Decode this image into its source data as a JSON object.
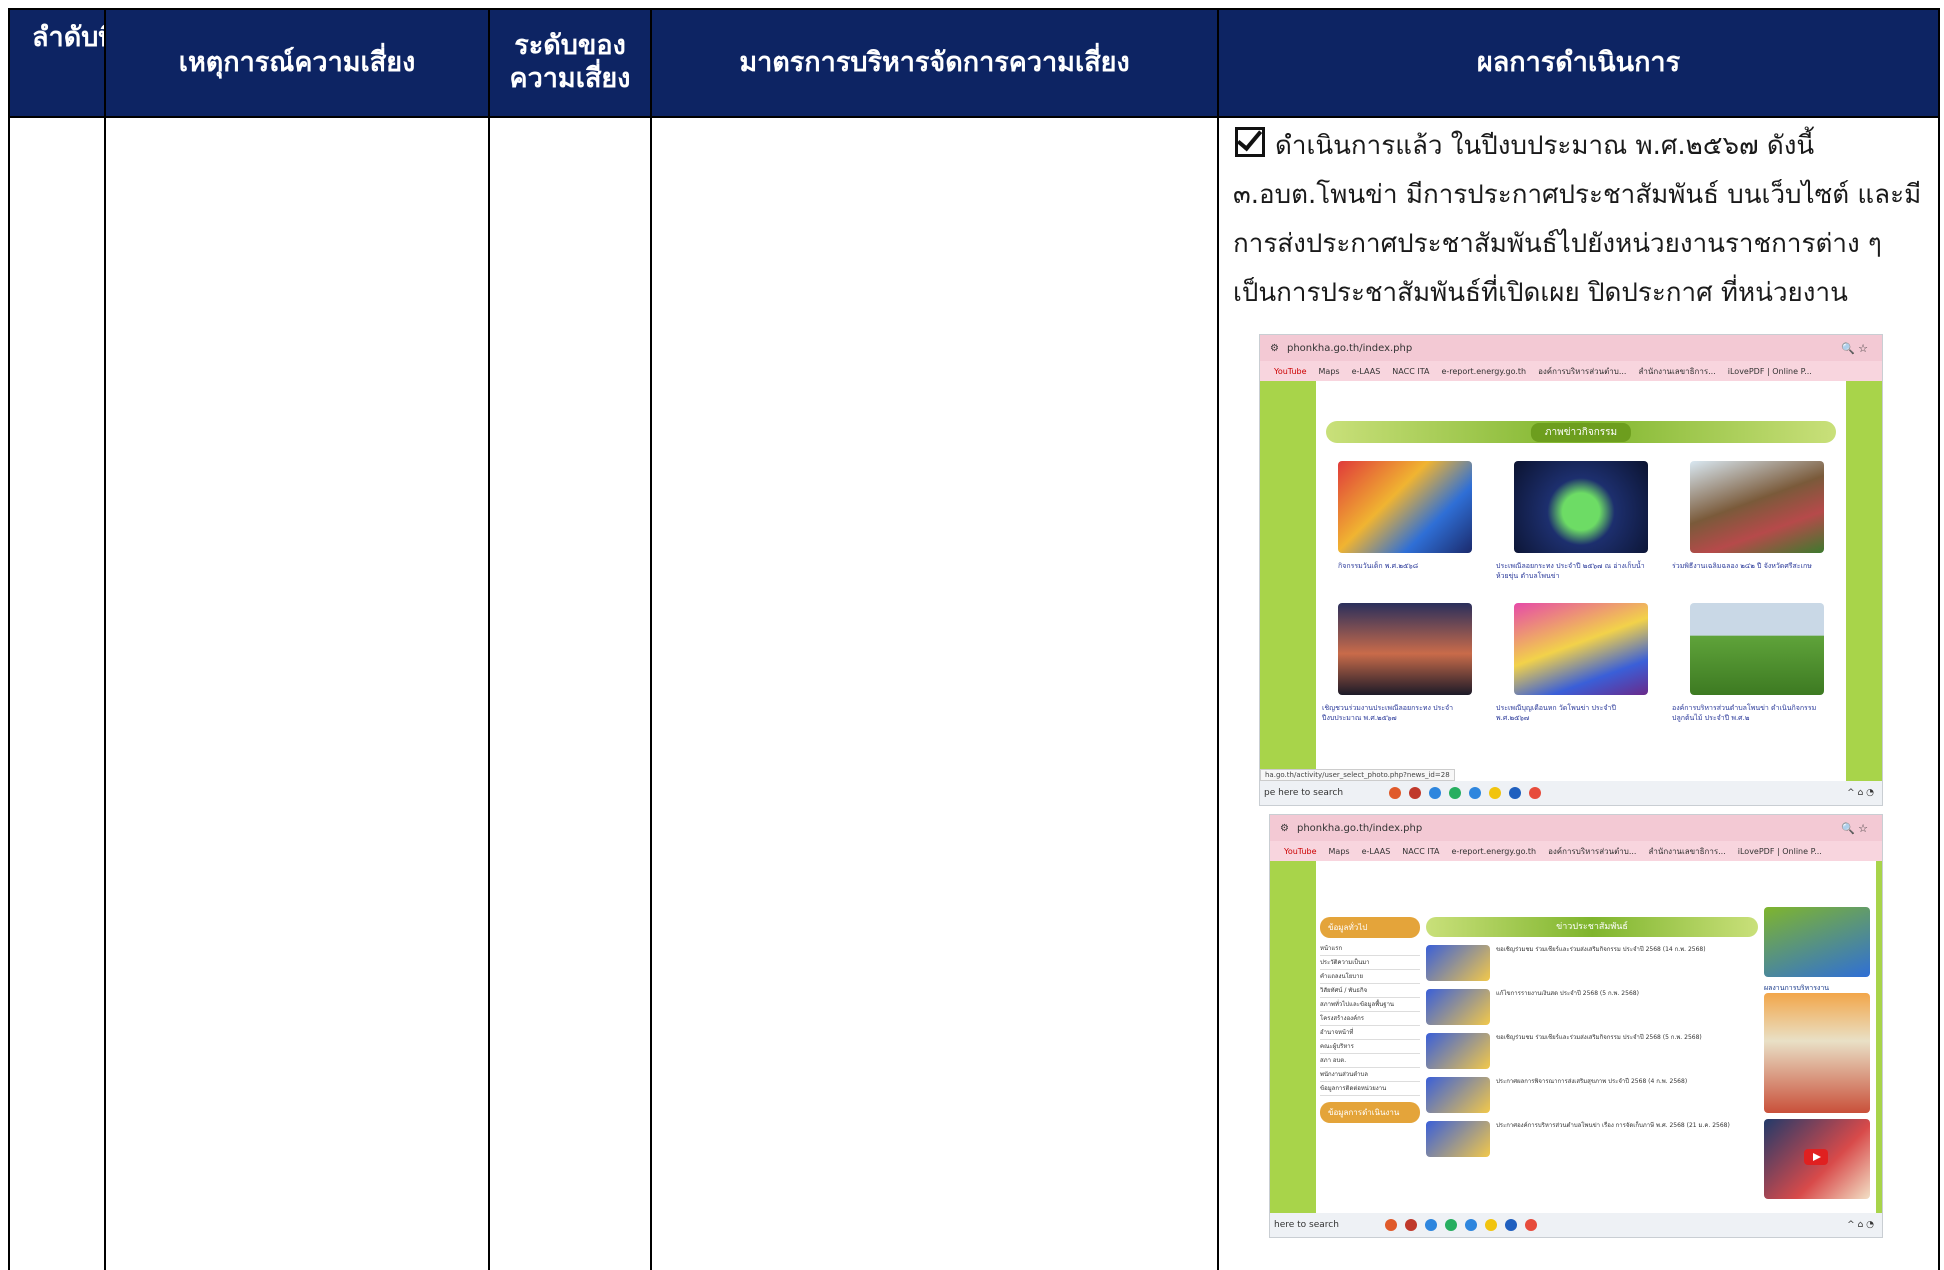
{
  "table": {
    "headers": {
      "seq": "ลำดับที่",
      "event": "เหตุการณ์ความเสี่ยง",
      "level_line1": "ระดับของ",
      "level_line2": "ความเสี่ยง",
      "measures": "มาตรการบริหารจัดการความเสี่ยง",
      "result": "ผลการดำเนินการ"
    },
    "header_bg": "#0d2463",
    "result": {
      "checked": true,
      "lines": [
        "ดำเนินการแล้ว  ในปีงบประมาณ พ.ศ.๒๕๖๗  ดังนี้",
        "๓.อบต.โพนข่า มีการประกาศประชาสัมพันธ์ บนเว็บไซต์ และมี",
        "การส่งประกาศประชาสัมพันธ์ไปยังหน่วยงานราชการต่าง ๆ",
        "เป็นการประชาสัมพันธ์ที่เปิดเผย ปิดประกาศ ที่หน่วยงาน"
      ]
    }
  },
  "screenshot1": {
    "url": "phonkha.go.th/index.php",
    "bookmarks": [
      "YouTube",
      "Maps",
      "e-LAAS",
      "NACC ITA",
      "e-report.energy.go.th",
      "องค์การบริหารส่วนตำบ...",
      "สำนักงานเลขาธิการ...",
      "iLovePDF | Online P..."
    ],
    "section_title": "ภาพข่าวกิจกรรม",
    "captions": [
      "กิจกรรมวันเด็ก พ.ศ.๒๕๖๘",
      "ประเพณีลอยกระทง ประจำปี ๒๕๖๗ ณ อ่างเก็บน้ำห้วยขุ่น ตำบลโพนข่า",
      "ร่วมพิธีงานเฉลิมฉลอง ๒๔๒ ปี จังหวัดศรีสะเกษ",
      "เชิญชวนร่วมงานประเพณีลอยกระทง ประจำปีงบประมาณ พ.ศ.๒๕๖๗",
      "ประเพณีบุญเดือนหก วัดโพนข่า ประจำปี พ.ศ.๒๕๖๗",
      "องค์การบริหารส่วนตำบลโพนข่า ดำเนินกิจกรรมปลูกต้นไม้ ประจำปี พ.ศ.๒"
    ],
    "status_url": "ha.go.th/activity/user_select_photo.php?news_id=28",
    "taskbar_search": "pe here to search"
  },
  "screenshot2": {
    "url": "phonkha.go.th/index.php",
    "bookmarks": [
      "YouTube",
      "Maps",
      "e-LAAS",
      "NACC ITA",
      "e-report.energy.go.th",
      "องค์การบริหารส่วนตำบ...",
      "สำนักงานเลขาธิการ...",
      "iLovePDF | Online P..."
    ],
    "side_head_1": "ข้อมูลทั่วไป",
    "side_head_2": "ข้อมูลการดำเนินงาน",
    "side_items": [
      "หน้าแรก",
      "ประวัติความเป็นมา",
      "คำแถลงนโยบาย",
      "วิสัยทัศน์ / พันธกิจ",
      "สภาพทั่วไปและข้อมูลพื้นฐาน",
      "โครงสร้างองค์กร",
      "อำนาจหน้าที่",
      "คณะผู้บริหาร",
      "สภา อบต.",
      "พนักงานส่วนตำบล",
      "ข้อมูลการติดต่อหน่วยงาน"
    ],
    "news_title": "ข่าวประชาสัมพันธ์",
    "news_items": [
      "ขอเชิญร่วมชม ร่วมเชียร์และร่วมส่งเสริมกิจกรรม ประจำปี 2568 (14 ก.พ. 2568)",
      "แก้ไขการรายงานเงินสด ประจำปี 2568 (5 ก.พ. 2568)",
      "ขอเชิญร่วมชม ร่วมเชียร์และร่วมส่งเสริมกิจกรรม ประจำปี 2568 (5 ก.พ. 2568)",
      "ประกาศผลการพิจารณาการส่งเสริมสุขภาพ ประจำปี 2568 (4 ก.พ. 2568)",
      "ประกาศองค์การบริหารส่วนตำบลโพนข่า เรื่อง การจัดเก็บภาษี พ.ศ. 2568 (21 ม.ค. 2568)"
    ],
    "aside_title": "ผลงานการบริหารงาน",
    "taskbar_search": "here to search"
  }
}
